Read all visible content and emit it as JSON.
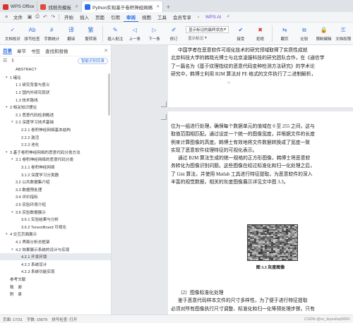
{
  "tabs": [
    {
      "label": "WPS Office",
      "color": "#d9342b"
    },
    {
      "label": "找稻壳模板",
      "color": "#e04a3c"
    },
    {
      "label": "Python实现基于卷积神经网络",
      "color": "#2a6ee8"
    }
  ],
  "menu": {
    "file_label": "文件",
    "items": [
      "开始",
      "插入",
      "页面",
      "引用",
      "审阅",
      "视图",
      "工具",
      "会员专享"
    ],
    "active_index": 4,
    "wps_ai": "WPS AI"
  },
  "ribbon": {
    "buttons": [
      "文档校对",
      "拼写检查",
      "字数统计",
      "翻译",
      "繁转简",
      "插入批注",
      "上一条",
      "下一条",
      "修订"
    ],
    "markup_select": "显示标记的最终状态",
    "markup_show": "显示标记",
    "right_buttons": [
      "接受",
      "拒绝",
      "翻页",
      "比较",
      "限制编辑",
      "文档权限"
    ]
  },
  "nav": {
    "tabs": [
      "目录",
      "章节",
      "书签",
      "查找和替换"
    ],
    "active_tab": 0,
    "smart_toc": "智能识别目录",
    "selected_index": 25,
    "items": [
      {
        "label": "ABSTRACT",
        "level": 1,
        "arrow": ""
      },
      {
        "label": "1 绪论",
        "level": 0,
        "arrow": "▾"
      },
      {
        "label": "1.1 研究背景与意义",
        "level": 1,
        "arrow": ""
      },
      {
        "label": "1.2 国内外研究现状",
        "level": 1,
        "arrow": ""
      },
      {
        "label": "1.3 技术路线",
        "level": 1,
        "arrow": ""
      },
      {
        "label": "2 相关知识理论",
        "level": 0,
        "arrow": "▾"
      },
      {
        "label": "2.1 恶意代码检测概述",
        "level": 1,
        "arrow": ""
      },
      {
        "label": "2.2 深度学习技术基础",
        "level": 1,
        "arrow": "▾"
      },
      {
        "label": "2.2.1 卷积神经网络基本结构",
        "level": 2,
        "arrow": ""
      },
      {
        "label": "2.2.2 激活",
        "level": 2,
        "arrow": ""
      },
      {
        "label": "2.2.3 池化",
        "level": 2,
        "arrow": ""
      },
      {
        "label": "3 基于卷积神经网络的恶意代码分类方法",
        "level": 0,
        "arrow": "▾"
      },
      {
        "label": "3.1 卷积神经网络的恶意代码分类",
        "level": 1,
        "arrow": "▾"
      },
      {
        "label": "3.1.1 卷积神经网络",
        "level": 2,
        "arrow": ""
      },
      {
        "label": "3.1.2 深度学习分类器",
        "level": 2,
        "arrow": ""
      },
      {
        "label": "3.2 公共数据集介绍",
        "level": 1,
        "arrow": ""
      },
      {
        "label": "3.3 数据预处理",
        "level": 1,
        "arrow": ""
      },
      {
        "label": "3.4 评价指标",
        "level": 1,
        "arrow": ""
      },
      {
        "label": "3.5 实验环境介绍",
        "level": 1,
        "arrow": ""
      },
      {
        "label": "3.6 实验数据展示",
        "level": 1,
        "arrow": "▾"
      },
      {
        "label": "3.6.1 实验结果与分析",
        "level": 2,
        "arrow": ""
      },
      {
        "label": "3.6.2 TensorBoard 可视化",
        "level": 2,
        "arrow": ""
      },
      {
        "label": "4 交互页面展示",
        "level": 0,
        "arrow": "▾"
      },
      {
        "label": "4.1 界面分析总框架",
        "level": 1,
        "arrow": ""
      },
      {
        "label": "4.2 效果展示系统的设计与实现",
        "level": 1,
        "arrow": "▾"
      },
      {
        "label": "4.2.1 开发环境",
        "level": 2,
        "arrow": ""
      },
      {
        "label": "4.2.2 系统设计",
        "level": 2,
        "arrow": ""
      },
      {
        "label": "4.2.3 系统功能实现",
        "level": 2,
        "arrow": ""
      },
      {
        "label": "参考文献",
        "level": 0,
        "arrow": ""
      },
      {
        "label": "致　谢",
        "level": 0,
        "arrow": ""
      },
      {
        "label": "附　录",
        "level": 0,
        "arrow": ""
      }
    ]
  },
  "document": {
    "page1_lines": [
      {
        "text": "中国学者在恶意软件可视化技术的研究领域取得了实质性成就",
        "indent": true
      },
      {
        "text": "北京科技大学的韩晓光博士与北京凌服科技的研究团队合作，在《通信学",
        "indent": false
      },
      {
        "text": "了一篇名为《基于纹理指纹的恶意代码变种检测方法研究》的学术论",
        "indent": false
      },
      {
        "text": "研究中，韩博士利用 B2M 算法对 PE 格式的文件执行了二进制解析，",
        "indent": false
      }
    ],
    "page2_lines_top": [
      {
        "text": "位为一组进行处理，确保每个数据单元的值域在 0 至 255 之间，这与",
        "indent": false
      },
      {
        "text": "取值范围相匹配。通过设定一个统一的图像宽度，并根据文件的长度",
        "indent": false
      },
      {
        "text": "例来计算图像的高度。韩博士有效地将文件数据转换成了宽度一致",
        "indent": false
      },
      {
        "text": "实现了恶意软件纹理特征的可视化表示。",
        "indent": false
      },
      {
        "text": "通过 B2M 算法生成的统一规格的正方形图像，韩博士将恶意软",
        "indent": true
      },
      {
        "text": "务转化为图像识别问题。这些图像在经过标准化和归一化处理之后，",
        "indent": false
      },
      {
        "text": "了 Gist 算法，并使用 Matlab 工具进行特征提取。为恶意软件的深入",
        "indent": false
      },
      {
        "text": "丰富的视觉数据，相关的灰度图像展示详见文中图 3.3。",
        "indent": false
      }
    ],
    "figure_caption": "图 3.3 灰度图像",
    "page2_lines_bottom": [
      {
        "text": "（2）图像标准化处理",
        "indent": true
      },
      {
        "text": "鉴于恶意代码样本文件的尺寸多样性，为了便于进行特征提取",
        "indent": true
      },
      {
        "text": "必须对所有图像执行尺寸调整、标准化和归一化等预处理步骤，只有",
        "indent": false
      }
    ]
  },
  "status": {
    "page": "页面: 17/31",
    "words": "字数: 15679",
    "spell": "拼写检查: 打开",
    "watermark": "CSDN @vx_biyesheji0001"
  }
}
